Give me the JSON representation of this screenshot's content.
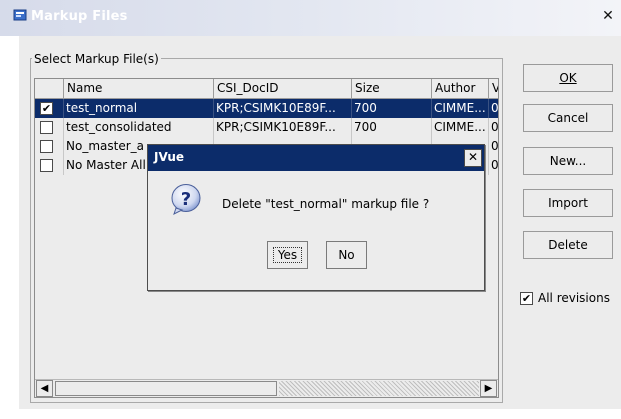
{
  "window": {
    "title": "Markup Files",
    "close_glyph": "✕"
  },
  "group": {
    "legend": "Select Markup File(s)"
  },
  "table": {
    "columns": [
      "",
      "Name",
      "CSI_DocID",
      "Size",
      "Author",
      "V"
    ],
    "rows": [
      {
        "checked": true,
        "check_glyph": "✔",
        "name": "test_normal",
        "docid": "KPR;CSIMK10E89F...",
        "size": "700",
        "author": "CIMME...",
        "v": "0"
      },
      {
        "checked": false,
        "check_glyph": "",
        "name": "test_consolidated",
        "docid": "KPR;CSIMK10E89F...",
        "size": "700",
        "author": "CIMME...",
        "v": "0"
      },
      {
        "checked": false,
        "check_glyph": "",
        "name": "No_master_a",
        "docid": "",
        "size": "",
        "author": "",
        "v": "0"
      },
      {
        "checked": false,
        "check_glyph": "",
        "name": "No Master All",
        "docid": "",
        "size": "",
        "author": "",
        "v": "0"
      }
    ],
    "selected_row": 0
  },
  "scrollbar": {
    "left_glyph": "◀",
    "right_glyph": "▶"
  },
  "buttons": {
    "ok": "OK",
    "cancel": "Cancel",
    "new": "New...",
    "import": "Import",
    "delete": "Delete"
  },
  "all_revisions": {
    "label": "All revisions",
    "checked": true,
    "check_glyph": "✔"
  },
  "dialog": {
    "title": "JVue",
    "message": "Delete \"test_normal\" markup file ?",
    "yes": "Yes",
    "no": "No",
    "close_glyph": "✕",
    "icon": "question-icon"
  },
  "colors": {
    "selection": "#0c2c6a",
    "background": "#ececec"
  }
}
